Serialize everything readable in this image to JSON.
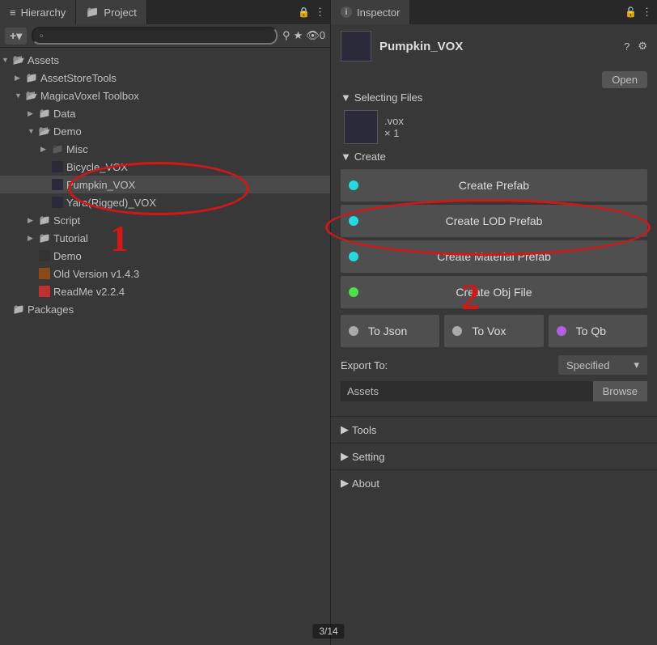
{
  "left": {
    "tabs": [
      {
        "label": "Hierarchy",
        "icon": "hierarchy"
      },
      {
        "label": "Project",
        "icon": "folder"
      }
    ],
    "toolbar": {
      "add": "+",
      "search_placeholder": "",
      "stats": "0"
    },
    "tree": [
      {
        "label": "Assets",
        "indent": 0,
        "icon": "folder-open",
        "arrow": "▼",
        "selected": false
      },
      {
        "label": "AssetStoreTools",
        "indent": 1,
        "icon": "folder",
        "arrow": "▶",
        "selected": false
      },
      {
        "label": "MagicaVoxel Toolbox",
        "indent": 1,
        "icon": "folder-open",
        "arrow": "▼",
        "selected": false
      },
      {
        "label": "Data",
        "indent": 2,
        "icon": "folder",
        "arrow": "▶",
        "selected": false
      },
      {
        "label": "Demo",
        "indent": 2,
        "icon": "folder-open",
        "arrow": "▼",
        "selected": false
      },
      {
        "label": "Misc",
        "indent": 3,
        "icon": "folder-dark",
        "arrow": "▶",
        "selected": false
      },
      {
        "label": "Bicycle_VOX",
        "indent": 3,
        "icon": "vox",
        "arrow": "",
        "selected": false
      },
      {
        "label": "Pumpkin_VOX",
        "indent": 3,
        "icon": "vox",
        "arrow": "",
        "selected": true
      },
      {
        "label": "Yara(Rigged)_VOX",
        "indent": 3,
        "icon": "vox",
        "arrow": "",
        "selected": false
      },
      {
        "label": "Script",
        "indent": 2,
        "icon": "folder",
        "arrow": "▶",
        "selected": false
      },
      {
        "label": "Tutorial",
        "indent": 2,
        "icon": "folder",
        "arrow": "▶",
        "selected": false
      },
      {
        "label": "Demo",
        "indent": 2,
        "icon": "unity",
        "arrow": "",
        "selected": false
      },
      {
        "label": "Old Version v1.4.3",
        "indent": 2,
        "icon": "zip",
        "arrow": "",
        "selected": false
      },
      {
        "label": "ReadMe v2.2.4",
        "indent": 2,
        "icon": "pdf",
        "arrow": "",
        "selected": false
      },
      {
        "label": "Packages",
        "indent": 0,
        "icon": "folder",
        "arrow": "",
        "selected": false
      }
    ]
  },
  "right": {
    "tab": "Inspector",
    "title": "Pumpkin_VOX",
    "open_btn": "Open",
    "sections": {
      "selecting": {
        "header": "Selecting Files",
        "ext": ".vox",
        "count": "× 1"
      },
      "create": {
        "header": "Create",
        "buttons": [
          {
            "label": "Create Prefab",
            "dot": "cyan"
          },
          {
            "label": "Create LOD Prefab",
            "dot": "cyan"
          },
          {
            "label": "Create Material Prefab",
            "dot": "cyan"
          },
          {
            "label": "Create Obj File",
            "dot": "green"
          }
        ],
        "row": [
          {
            "label": "To Json",
            "dot": "gray"
          },
          {
            "label": "To Vox",
            "dot": "gray"
          },
          {
            "label": "To Qb",
            "dot": "purple"
          }
        ]
      },
      "export": {
        "label": "Export To:",
        "dropdown": "Specified",
        "path": "Assets",
        "browse": "Browse"
      },
      "tools": "Tools",
      "setting": "Setting",
      "about": "About"
    }
  },
  "annotations": {
    "one": "1",
    "two": "2"
  },
  "page": "3/14"
}
